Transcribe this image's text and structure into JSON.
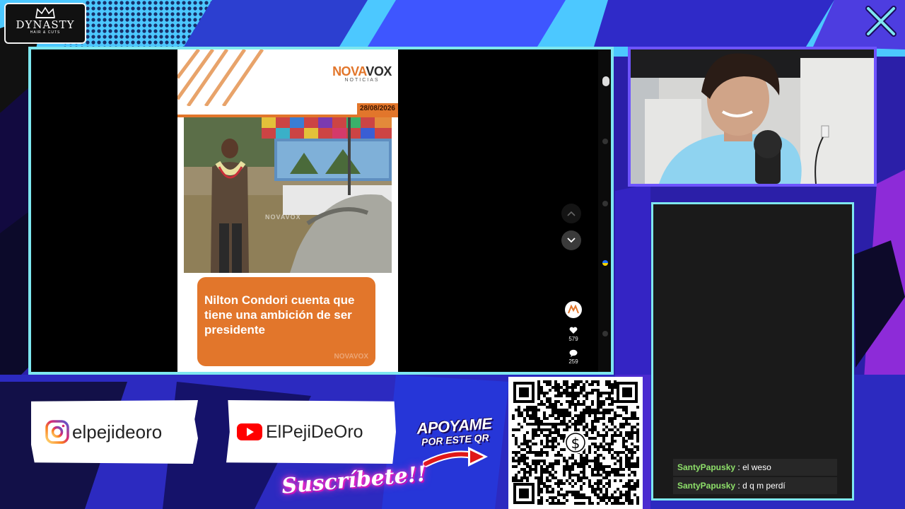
{
  "brand": {
    "name": "DYNASTY",
    "tagline": "HAIR & CUTS"
  },
  "video": {
    "source_logo_a": "NOVA",
    "source_logo_b": "VOX",
    "source_sub": "NOTICIAS",
    "date": "28/08/2026",
    "photo_watermark": "NOVAVOX",
    "headline": "Nilton Condori cuenta que tiene una ambición de ser presidente",
    "headline_watermark": "NOVAVOX",
    "likes": "579",
    "comments": "259"
  },
  "chat": {
    "messages": [
      {
        "user": "SantyPapusky",
        "text": "el weso"
      },
      {
        "user": "SantyPapusky",
        "text": "d q m perdí"
      }
    ]
  },
  "socials": {
    "instagram": "elpejideoro",
    "youtube": "ElPejiDeOro"
  },
  "support": {
    "title_line1": "APOYAME",
    "title_line2": "POR ESTE QR",
    "subscribe": "Suscríbete!!"
  },
  "colors": {
    "frame": "#7ee7ef",
    "webcam_frame": "#6e54ff",
    "accent_orange": "#e2762b",
    "chat_user": "#8ee06a"
  },
  "icons": [
    "crown-icon",
    "close-icon",
    "chevron-up-icon",
    "chevron-down-icon",
    "heart-icon",
    "comment-icon",
    "instagram-icon",
    "youtube-icon",
    "arrow-icon",
    "dollar-icon"
  ]
}
